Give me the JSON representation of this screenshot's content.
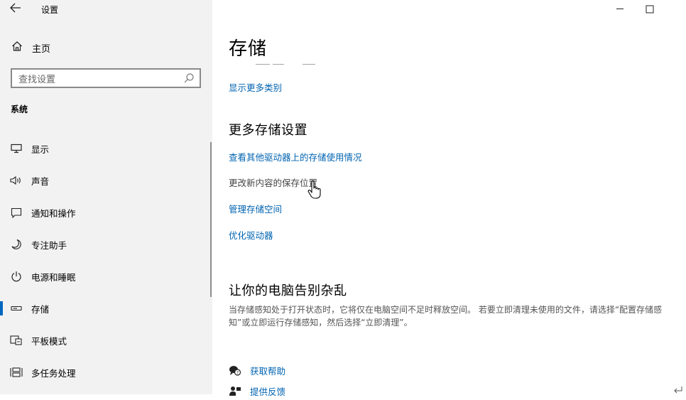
{
  "window": {
    "title": "设置",
    "controls": [
      "minimize-icon",
      "maximize-icon"
    ]
  },
  "sidebar": {
    "home_label": "主页",
    "search_placeholder": "查找设置",
    "section_label": "系统",
    "items": [
      {
        "label": "显示",
        "icon": "monitor-icon"
      },
      {
        "label": "声音",
        "icon": "speaker-icon"
      },
      {
        "label": "通知和操作",
        "icon": "notification-icon"
      },
      {
        "label": "专注助手",
        "icon": "moon-icon"
      },
      {
        "label": "电源和睡眠",
        "icon": "power-icon"
      },
      {
        "label": "存储",
        "icon": "storage-icon",
        "active": true
      },
      {
        "label": "平板模式",
        "icon": "tablet-mode-icon"
      },
      {
        "label": "多任务处理",
        "icon": "multitasking-icon"
      }
    ]
  },
  "main": {
    "title": "存储",
    "show_more_link": "显示更多类别",
    "more_settings": {
      "heading": "更多存储设置",
      "links": [
        "查看其他驱动器上的存储使用情况",
        "更改新内容的保存位置",
        "管理存储空间",
        "优化驱动器"
      ]
    },
    "declutter": {
      "heading": "让你的电脑告别杂乱",
      "description": "当存储感知处于打开状态时，它将仅在电脑空间不足时释放空间。 若要立即清理未使用的文件，请选择“配置存储感知”或立即运行存储感知，然后选择“立即清理”。"
    },
    "help": {
      "get_help": "获取帮助",
      "feedback": "提供反馈"
    }
  },
  "colors": {
    "accent": "#0067c0",
    "link": "#0063b1",
    "sidebar_bg": "#f2f2f2"
  }
}
